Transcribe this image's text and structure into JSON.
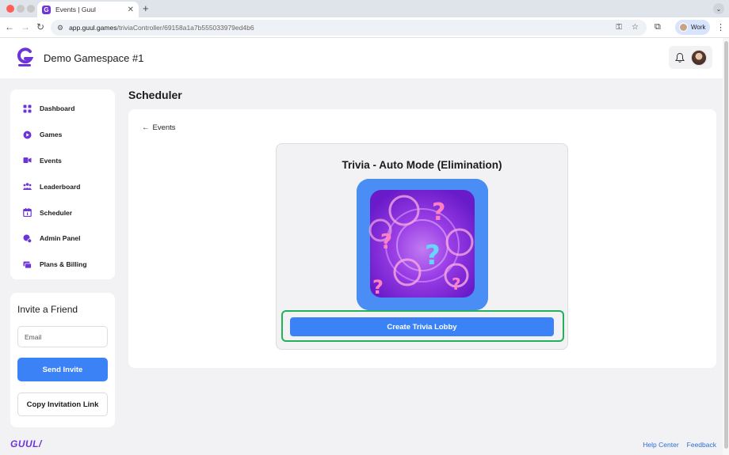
{
  "browser": {
    "tab_title": "Events | Guul",
    "tab_favicon_letter": "G",
    "url_domain": "app.guul.games",
    "url_path": "/triviaController/69158a1a7b555033979ed4b6",
    "profile_label": "Work"
  },
  "header": {
    "workspace_title": "Demo Gamespace #1"
  },
  "sidebar": {
    "items": [
      {
        "label": "Dashboard",
        "icon": "grid-icon"
      },
      {
        "label": "Games",
        "icon": "play-icon"
      },
      {
        "label": "Events",
        "icon": "events-icon"
      },
      {
        "label": "Leaderboard",
        "icon": "people-icon"
      },
      {
        "label": "Scheduler",
        "icon": "calendar-icon"
      },
      {
        "label": "Admin Panel",
        "icon": "admin-icon"
      },
      {
        "label": "Plans & Billing",
        "icon": "billing-icon"
      }
    ]
  },
  "invite": {
    "title": "Invite a Friend",
    "email_placeholder": "Email",
    "send_label": "Send Invite",
    "copy_label": "Copy Invitation Link"
  },
  "main": {
    "page_title": "Scheduler",
    "back_label": "Events",
    "event_title": "Trivia - Auto Mode (Elimination)",
    "create_label": "Create Trivia Lobby"
  },
  "footer": {
    "logo_text": "GUUL/",
    "help_label": "Help Center",
    "feedback_label": "Feedback"
  },
  "colors": {
    "brand_purple": "#6d35d8",
    "primary_blue": "#3b82f6",
    "highlight_green": "#22b05a"
  }
}
